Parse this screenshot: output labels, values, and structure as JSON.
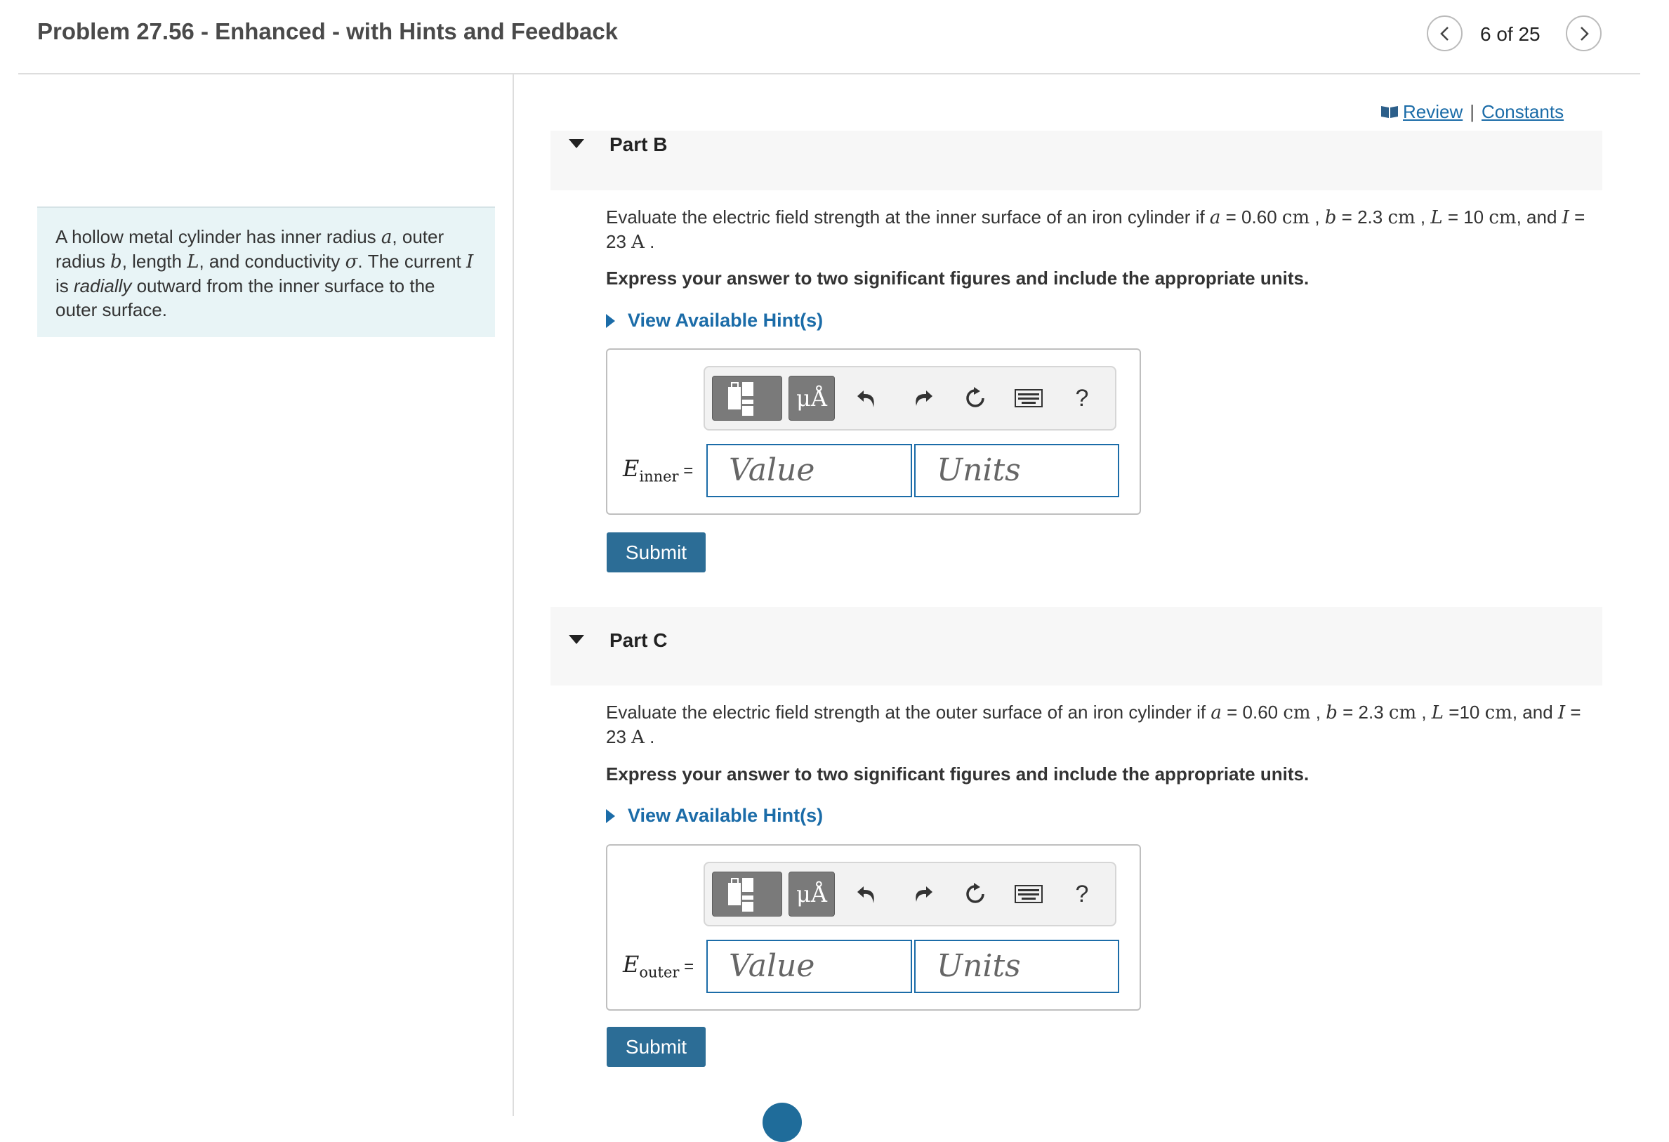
{
  "header": {
    "title": "Problem 27.56 - Enhanced - with Hints and Feedback",
    "page_counter": "6 of 25",
    "prev_icon": "chevron-left-icon",
    "next_icon": "chevron-right-icon"
  },
  "intro": {
    "t1": "A hollow metal cylinder has inner radius ",
    "v_a": "a",
    "t2": ", outer radius ",
    "v_b": "b",
    "t3": ", length ",
    "v_L": "L",
    "t4": ", and conductivity ",
    "v_sigma": "σ",
    "t5": ". The current ",
    "v_I": "I",
    "t6": " is ",
    "emph": "radially",
    "t7": " outward from the inner surface to the outer surface."
  },
  "links": {
    "review": "Review",
    "separator": "|",
    "constants": "Constants"
  },
  "part_b": {
    "title": "Part B",
    "q1": "Evaluate the electric field strength at the inner surface of an iron cylinder if ",
    "a_var": "a",
    "a_eq": " = 0.60 ",
    "a_unit": "cm",
    "sep1": " , ",
    "b_var": "b",
    "b_eq": " = 2.3 ",
    "b_unit": "cm",
    "sep2": " , ",
    "L_var": "L",
    "L_eq": " = 10 ",
    "L_unit": "cm",
    "and": ", and ",
    "I_var": "I",
    "I_eq": " = 23 ",
    "I_unit": "A",
    "end": " .",
    "instruction": "Express your answer to two significant figures and include the appropriate units.",
    "hint": "View Available Hint(s)",
    "label_var": "E",
    "label_sub": "inner",
    "label_eq": " =",
    "value_placeholder": "Value",
    "units_placeholder": "Units",
    "submit": "Submit"
  },
  "part_c": {
    "title": "Part C",
    "q1": "Evaluate the electric field strength at the outer surface of an iron cylinder if ",
    "a_var": "a",
    "a_eq": " = 0.60 ",
    "a_unit": "cm",
    "sep1": " , ",
    "b_var": "b",
    "b_eq": " = 2.3 ",
    "b_unit": "cm",
    "sep2": " , ",
    "L_var": "L",
    "L_eq": " =10 ",
    "L_unit": "cm",
    "and": ", and ",
    "I_var": "I",
    "I_eq": " = 23 ",
    "I_unit": "A",
    "end": " .",
    "instruction": "Express your answer to two significant figures and include the appropriate units.",
    "hint": "View Available Hint(s)",
    "label_var": "E",
    "label_sub": "outer",
    "label_eq": " =",
    "value_placeholder": "Value",
    "units_placeholder": "Units",
    "submit": "Submit"
  },
  "toolbar": {
    "units_button": "μÅ",
    "help": "?",
    "icons": [
      "templates-icon",
      "units-icon",
      "undo-icon",
      "redo-icon",
      "reset-icon",
      "keyboard-icon",
      "help-icon"
    ]
  },
  "colors": {
    "accent": "#1b6ca8",
    "submit_bg": "#2c6d96",
    "intro_bg": "#e8f4f6",
    "part_header_bg": "#f7f7f7"
  }
}
